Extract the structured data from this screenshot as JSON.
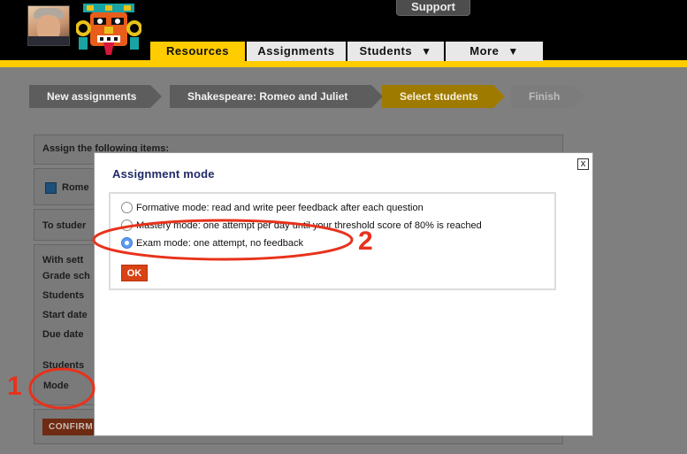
{
  "header": {
    "support_label": "Support",
    "tabs": [
      {
        "label": "Resources",
        "arrow": ""
      },
      {
        "label": "Assignments",
        "arrow": ""
      },
      {
        "label": "Students",
        "arrow": "▼"
      },
      {
        "label": "More",
        "arrow": "▼"
      }
    ],
    "active_tab": "Resources",
    "accent": "#ffcc00"
  },
  "steps": [
    {
      "label": "New assignments",
      "state": "done"
    },
    {
      "label": "Shakespeare: Romeo and Juliet",
      "state": "done"
    },
    {
      "label": "Select students",
      "state": "current"
    },
    {
      "label": "Finish",
      "state": "upcoming"
    }
  ],
  "form": {
    "assign_heading": "Assign the following items:",
    "item_label": "Rome",
    "to_students": "To studer",
    "with_settings": "With sett",
    "grade_scheme": "Grade sch",
    "students": "Students",
    "start_date": "Start date",
    "due_date": "Due date",
    "students_2": "Students",
    "mode": "Mode",
    "confirm_label": "CONFIRM"
  },
  "modal": {
    "title": "Assignment mode",
    "close_glyph": "x",
    "options": [
      {
        "label": "Formative mode: read and write peer feedback after each question",
        "checked": false
      },
      {
        "label": "Mastery mode: one attempt per day until your threshold score of 80% is reached",
        "checked": false
      },
      {
        "label": "Exam mode: one attempt, no feedback",
        "checked": true
      }
    ],
    "ok_label": "OK"
  },
  "annotations": {
    "label_1": "1",
    "label_2": "2",
    "color": "#e8321b"
  }
}
